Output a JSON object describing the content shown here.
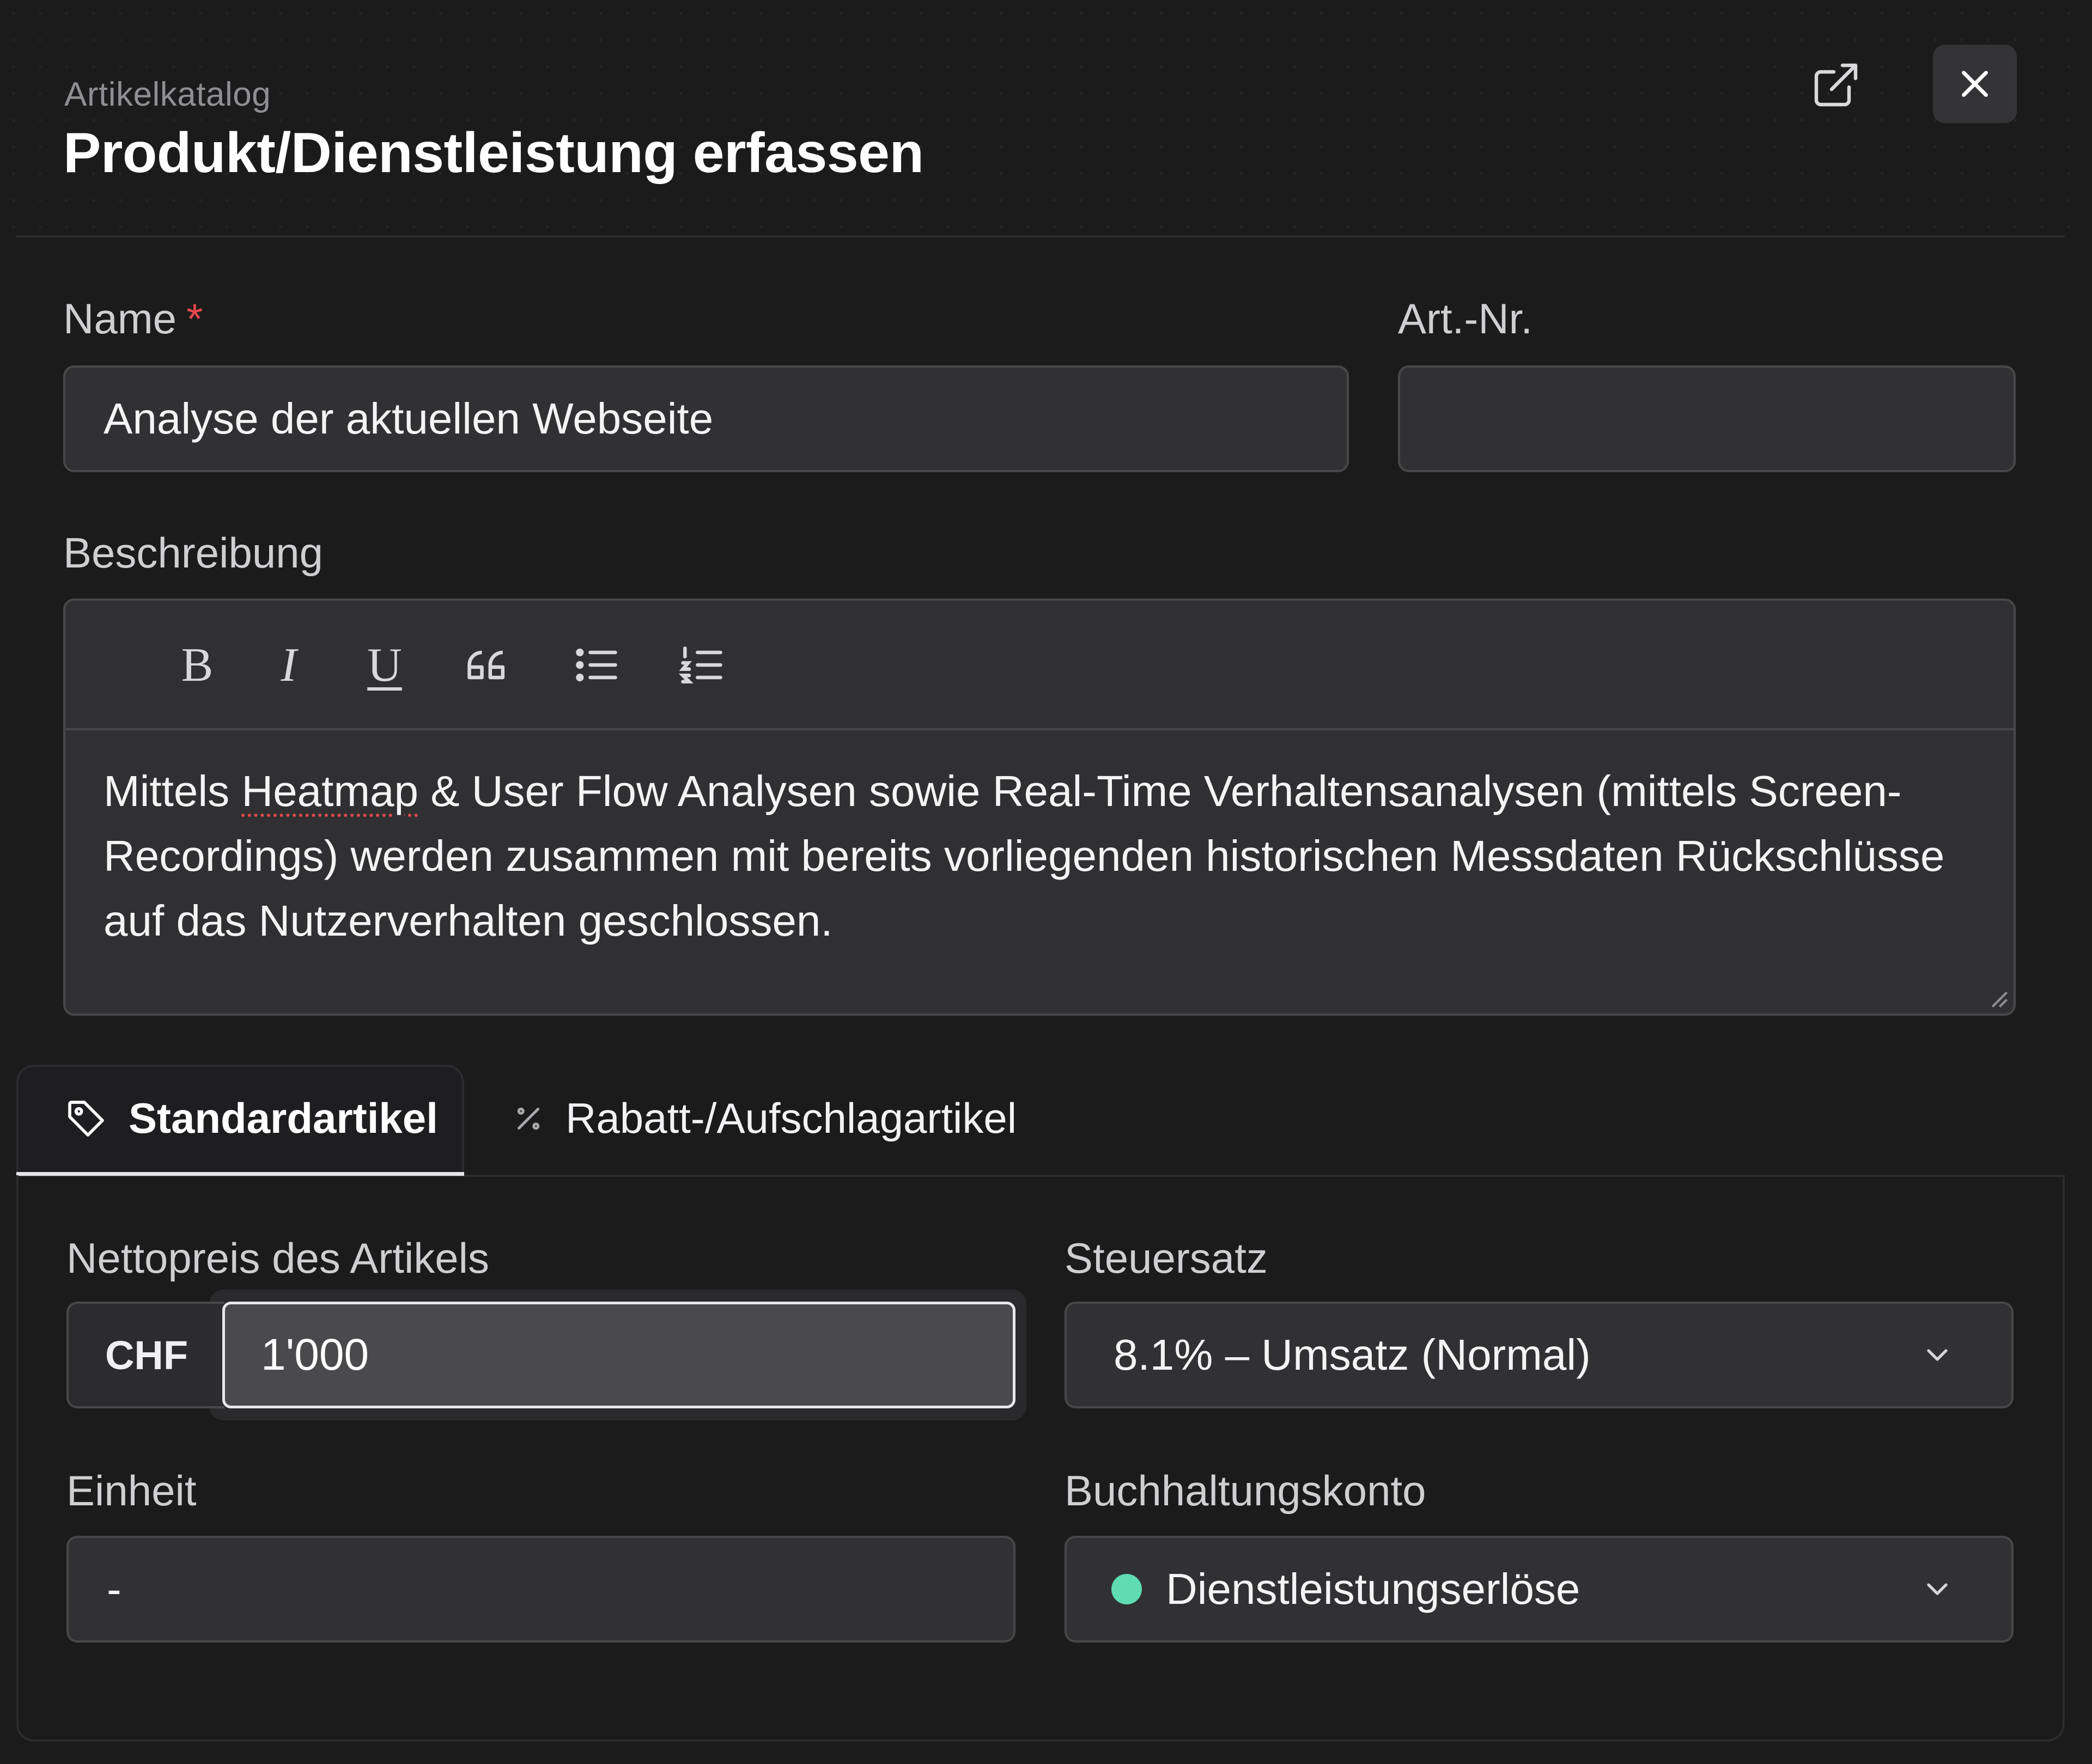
{
  "header": {
    "eyebrow": "Artikelkatalog",
    "title": "Produkt/Dienstleistung erfassen"
  },
  "form": {
    "name_label": "Name",
    "required_mark": "*",
    "name_value": "Analyse der aktuellen Webseite",
    "artnr_label": "Art.-Nr.",
    "artnr_value": "",
    "description_label": "Beschreibung",
    "toolbar": [
      "bold",
      "italic",
      "underline",
      "blockquote",
      "bullet-list",
      "numbered-list"
    ],
    "toolbar_glyphs": {
      "bold": "B",
      "italic": "I",
      "underline": "U"
    },
    "description": {
      "before": "Mittels ",
      "misspelled": "Heatmap",
      "after": " & User Flow Analysen sowie Real-Time Verhaltensanalysen (mittels Screen-Recordings) werden zusammen mit bereits vorliegenden historischen Messdaten Rückschlüsse auf das Nutzerverhalten geschlossen."
    }
  },
  "tabs": [
    {
      "label": "Standardartikel",
      "icon": "tag-icon",
      "active": true
    },
    {
      "label": "Rabatt-/Aufschlagartikel",
      "icon": "percent-icon",
      "active": false
    }
  ],
  "pricing": {
    "net_price_label": "Nettopreis des Artikels",
    "currency": "CHF",
    "net_price_value": "1'000",
    "tax_label": "Steuersatz",
    "tax_value": "8.1% – Umsatz (Normal)",
    "unit_label": "Einheit",
    "unit_value": "-",
    "account_label": "Buchhaltungskonto",
    "account_value": "Dienstleistungserlöse",
    "account_dot_color": "#5fdcb1"
  },
  "colors": {
    "background": "#1b1b1c",
    "required": "#e5484d",
    "field": "#313133"
  }
}
